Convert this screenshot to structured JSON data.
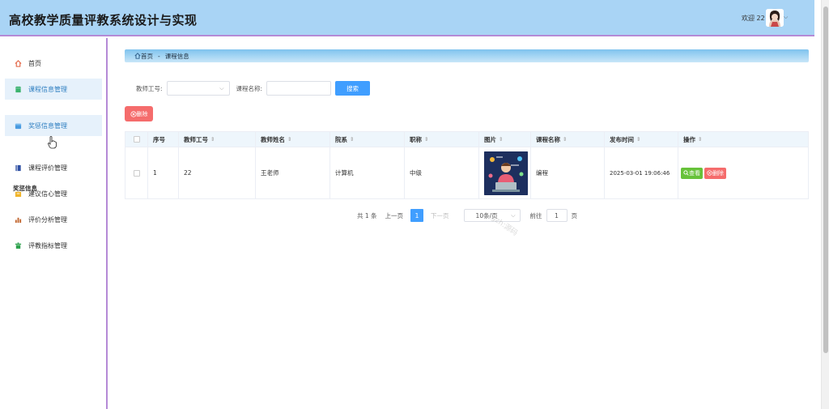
{
  "header": {
    "title": "高校教学质量评教系统设计与实现",
    "welcome": "欢迎 22"
  },
  "sidebar": {
    "items": [
      {
        "label": "首页",
        "icon": "home-icon",
        "color": "#e46a4b"
      },
      {
        "label": "课程信息管理",
        "icon": "shop-icon",
        "color": "#3bb36e"
      },
      {
        "label": "奖惩信息管理",
        "icon": "folder-icon",
        "color": "#4a9be0"
      },
      {
        "label": "课程评价管理",
        "icon": "book-icon",
        "color": "#2d4fa3"
      },
      {
        "label": "建议信心管理",
        "icon": "box-icon",
        "color": "#f0b42a"
      },
      {
        "label": "评价分析管理",
        "icon": "chart-icon",
        "color": "#c0622a"
      },
      {
        "label": "评教指标管理",
        "icon": "trash-icon",
        "color": "#2fa24e"
      }
    ],
    "group_title": "奖惩信息"
  },
  "breadcrumb": {
    "home": "首页",
    "separator": "-",
    "current": "课程信息"
  },
  "search": {
    "teacher_no_label": "教师工号:",
    "course_name_label": "课程名称:",
    "button": "搜索"
  },
  "toolbar": {
    "delete_label": "删除"
  },
  "table": {
    "headers": [
      "序号",
      "教师工号",
      "教师姓名",
      "院系",
      "职称",
      "图片",
      "课程名称",
      "发布时间",
      "操作"
    ],
    "rows": [
      {
        "index": "1",
        "teacher_no": "22",
        "teacher_name": "王老师",
        "department": "计算机",
        "title": "中级",
        "course_name": "编程",
        "publish_time": "2025-03-01 19:06:46",
        "view_label": "查看",
        "delete_label": "删除"
      }
    ]
  },
  "pagination": {
    "total": "共 1 条",
    "prev": "上一页",
    "current_page": "1",
    "next": "下一页",
    "page_size": "10条/页",
    "goto_label": "前往",
    "goto_value": "1",
    "page_unit": "页"
  },
  "watermark": "gzh:源码"
}
